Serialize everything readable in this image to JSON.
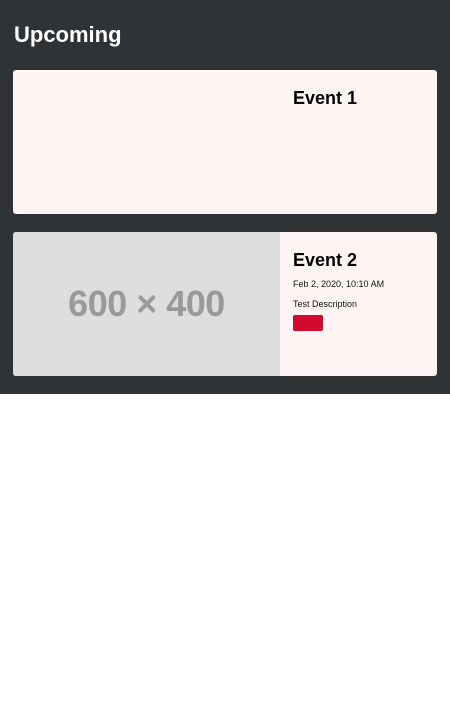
{
  "section": {
    "title": "Upcoming"
  },
  "events": [
    {
      "title": "Event 1",
      "date": "",
      "description": "",
      "image_text": ""
    },
    {
      "title": "Event 2",
      "date": "Feb 2, 2020, 10:10 AM",
      "description": "Test Description",
      "image_text": "600 × 400"
    }
  ],
  "colors": {
    "section_bg": "#2f3336",
    "card_bg": "#fff4f4",
    "placeholder_bg": "#dddddd",
    "button_bg": "#d10a2e"
  }
}
